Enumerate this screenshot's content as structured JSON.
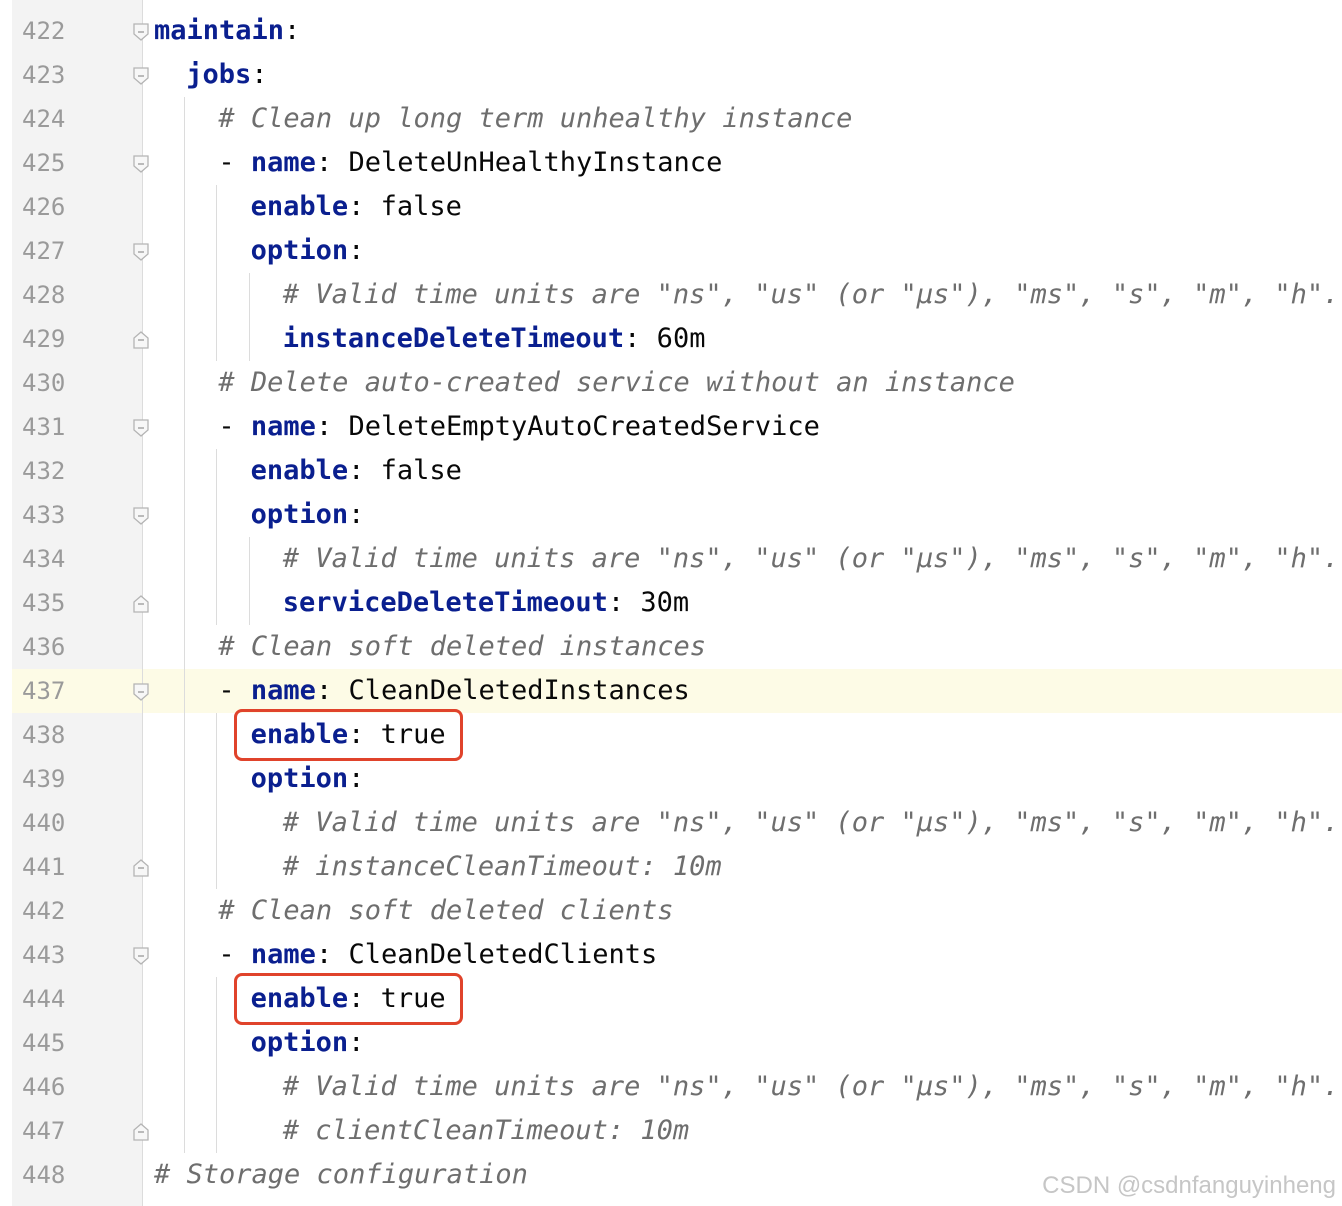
{
  "editor": {
    "lines": [
      {
        "num": "422",
        "indent": 0,
        "tokens": [
          {
            "t": "maintain",
            "s": "k"
          },
          {
            "t": ":",
            "s": "p"
          }
        ],
        "fold": "open"
      },
      {
        "num": "423",
        "indent": 1,
        "tokens": [
          {
            "t": "jobs",
            "s": "k"
          },
          {
            "t": ":",
            "s": "p"
          }
        ],
        "fold": "open"
      },
      {
        "num": "424",
        "indent": 2,
        "tokens": [
          {
            "t": "# Clean up long term unhealthy instance",
            "s": "c"
          }
        ],
        "fold": ""
      },
      {
        "num": "425",
        "indent": 2,
        "tokens": [
          {
            "t": "- ",
            "s": "p"
          },
          {
            "t": "name",
            "s": "k"
          },
          {
            "t": ": DeleteUnHealthyInstance",
            "s": "p"
          }
        ],
        "fold": "open"
      },
      {
        "num": "426",
        "indent": 3,
        "tokens": [
          {
            "t": "enable",
            "s": "k"
          },
          {
            "t": ": false",
            "s": "p"
          }
        ],
        "fold": ""
      },
      {
        "num": "427",
        "indent": 3,
        "tokens": [
          {
            "t": "option",
            "s": "k"
          },
          {
            "t": ":",
            "s": "p"
          }
        ],
        "fold": "open"
      },
      {
        "num": "428",
        "indent": 4,
        "tokens": [
          {
            "t": "# Valid time units are \"ns\", \"us\" (or \"µs\"), \"ms\", \"s\", \"m\", \"h\".",
            "s": "c"
          }
        ],
        "fold": ""
      },
      {
        "num": "429",
        "indent": 4,
        "tokens": [
          {
            "t": "instanceDeleteTimeout",
            "s": "k"
          },
          {
            "t": ": 60m",
            "s": "p"
          }
        ],
        "fold": "close"
      },
      {
        "num": "430",
        "indent": 2,
        "tokens": [
          {
            "t": "# Delete auto-created service without an instance",
            "s": "c"
          }
        ],
        "fold": ""
      },
      {
        "num": "431",
        "indent": 2,
        "tokens": [
          {
            "t": "- ",
            "s": "p"
          },
          {
            "t": "name",
            "s": "k"
          },
          {
            "t": ": DeleteEmptyAutoCreatedService",
            "s": "p"
          }
        ],
        "fold": "open"
      },
      {
        "num": "432",
        "indent": 3,
        "tokens": [
          {
            "t": "enable",
            "s": "k"
          },
          {
            "t": ": false",
            "s": "p"
          }
        ],
        "fold": ""
      },
      {
        "num": "433",
        "indent": 3,
        "tokens": [
          {
            "t": "option",
            "s": "k"
          },
          {
            "t": ":",
            "s": "p"
          }
        ],
        "fold": "open"
      },
      {
        "num": "434",
        "indent": 4,
        "tokens": [
          {
            "t": "# Valid time units are \"ns\", \"us\" (or \"µs\"), \"ms\", \"s\", \"m\", \"h\".",
            "s": "c"
          }
        ],
        "fold": ""
      },
      {
        "num": "435",
        "indent": 4,
        "tokens": [
          {
            "t": "serviceDeleteTimeout",
            "s": "k"
          },
          {
            "t": ": 30m",
            "s": "p"
          }
        ],
        "fold": "close"
      },
      {
        "num": "436",
        "indent": 2,
        "tokens": [
          {
            "t": "# Clean soft deleted instances",
            "s": "c"
          }
        ],
        "fold": ""
      },
      {
        "num": "437",
        "indent": 2,
        "tokens": [
          {
            "t": "- ",
            "s": "p"
          },
          {
            "t": "name",
            "s": "k"
          },
          {
            "t": ": CleanDeletedInstances",
            "s": "p"
          }
        ],
        "fold": "open",
        "current": true
      },
      {
        "num": "438",
        "indent": 3,
        "tokens": [
          {
            "t": "enable",
            "s": "k"
          },
          {
            "t": ": true",
            "s": "p"
          }
        ],
        "fold": "",
        "boxed": true
      },
      {
        "num": "439",
        "indent": 3,
        "tokens": [
          {
            "t": "option",
            "s": "k"
          },
          {
            "t": ":",
            "s": "p"
          }
        ],
        "fold": ""
      },
      {
        "num": "440",
        "indent": 4,
        "tokens": [
          {
            "t": "# Valid time units are \"ns\", \"us\" (or \"µs\"), \"ms\", \"s\", \"m\", \"h\".",
            "s": "c"
          }
        ],
        "fold": ""
      },
      {
        "num": "441",
        "indent": 4,
        "tokens": [
          {
            "t": "# instanceCleanTimeout: 10m",
            "s": "c"
          }
        ],
        "fold": "close"
      },
      {
        "num": "442",
        "indent": 2,
        "tokens": [
          {
            "t": "# Clean soft deleted clients",
            "s": "c"
          }
        ],
        "fold": ""
      },
      {
        "num": "443",
        "indent": 2,
        "tokens": [
          {
            "t": "- ",
            "s": "p"
          },
          {
            "t": "name",
            "s": "k"
          },
          {
            "t": ": CleanDeletedClients",
            "s": "p"
          }
        ],
        "fold": "open"
      },
      {
        "num": "444",
        "indent": 3,
        "tokens": [
          {
            "t": "enable",
            "s": "k"
          },
          {
            "t": ": true",
            "s": "p"
          }
        ],
        "fold": "",
        "boxed": true
      },
      {
        "num": "445",
        "indent": 3,
        "tokens": [
          {
            "t": "option",
            "s": "k"
          },
          {
            "t": ":",
            "s": "p"
          }
        ],
        "fold": ""
      },
      {
        "num": "446",
        "indent": 4,
        "tokens": [
          {
            "t": "# Valid time units are \"ns\", \"us\" (or \"µs\"), \"ms\", \"s\", \"m\", \"h\".",
            "s": "c"
          }
        ],
        "fold": ""
      },
      {
        "num": "447",
        "indent": 4,
        "tokens": [
          {
            "t": "# clientCleanTimeout: 10m",
            "s": "c"
          }
        ],
        "fold": "close"
      },
      {
        "num": "448",
        "indent": 0,
        "tokens": [
          {
            "t": "# Storage configuration",
            "s": "c"
          }
        ],
        "fold": ""
      }
    ]
  },
  "watermark": "CSDN @csdnfanguyinheng",
  "colors": {
    "keyword": "#0a1f8f",
    "comment": "#6e6e6e",
    "highlight_box": "#e0432b",
    "current_line": "#fdfbe6"
  }
}
